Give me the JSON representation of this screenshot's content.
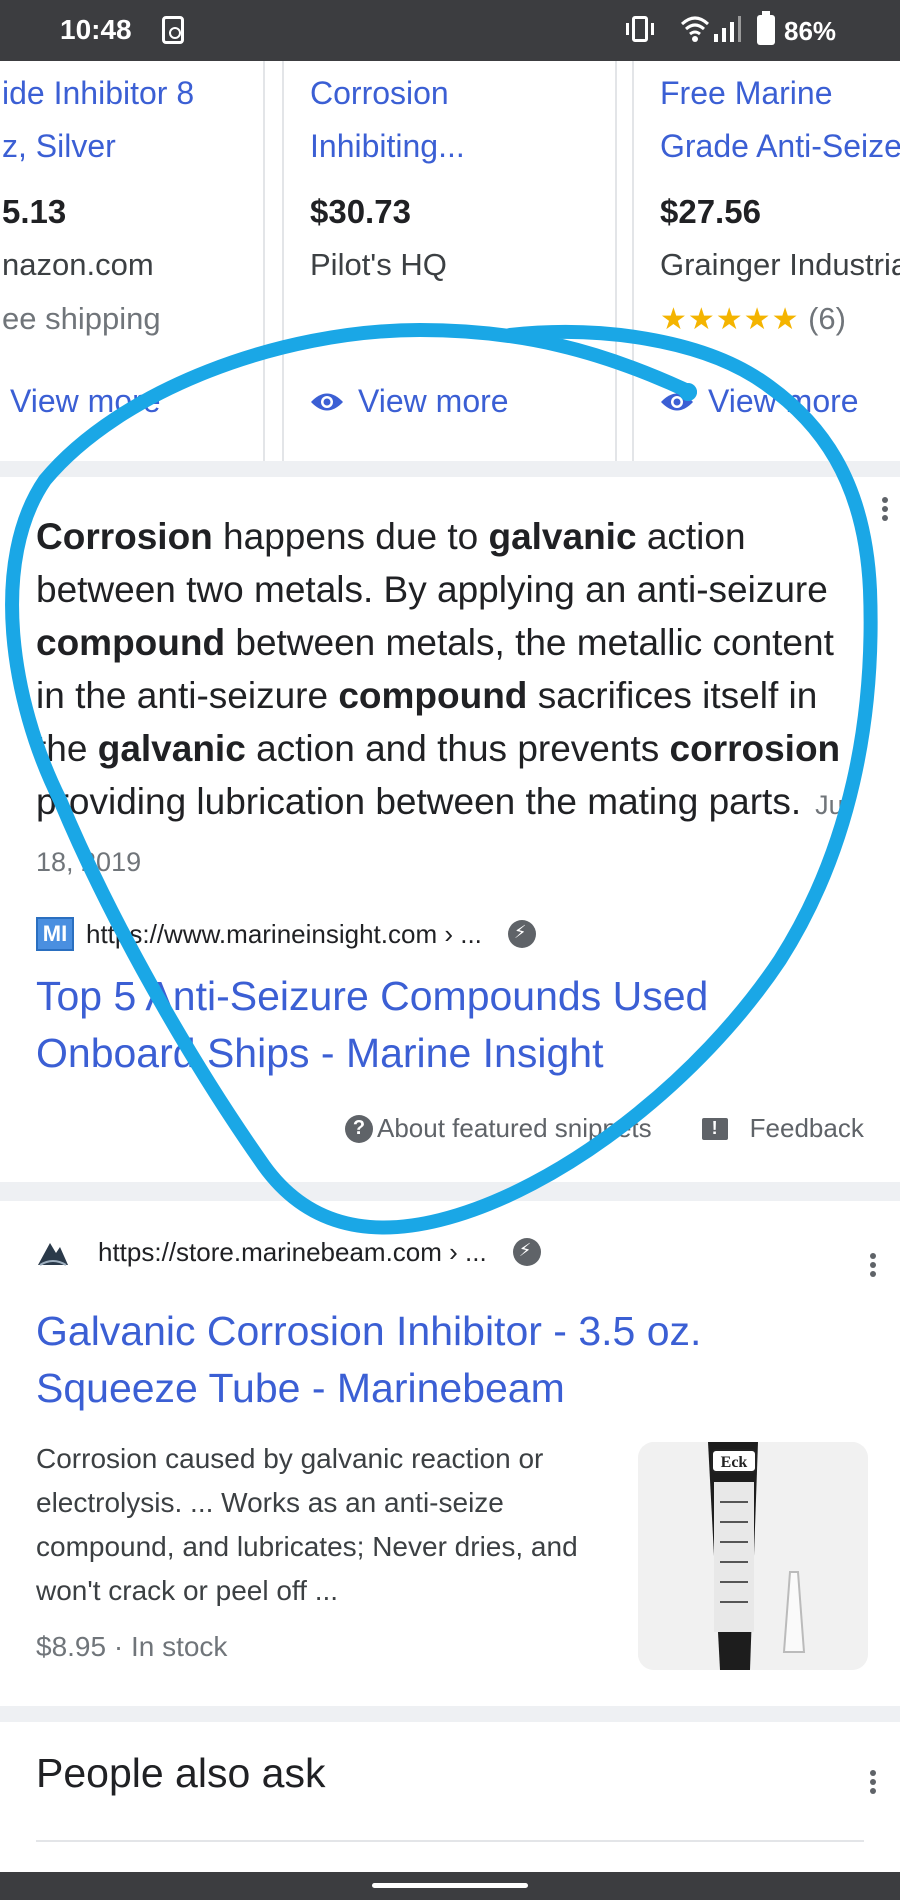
{
  "status_bar": {
    "time": "10:48",
    "battery": "86%"
  },
  "carousel": [
    {
      "title": [
        "ide Inhibitor 8",
        "z, Silver"
      ],
      "price": "5.13",
      "store": "nazon.com",
      "extra": "ee shipping",
      "view_label": "View more"
    },
    {
      "title": [
        "Corrosion",
        "Inhibiting..."
      ],
      "price": "$30.73",
      "store": "Pilot's HQ",
      "extra": "",
      "view_label": "View more"
    },
    {
      "title": [
        "Free Marine",
        "Grade Anti-Seize"
      ],
      "price": "$27.56",
      "store": "Grainger Industrial",
      "stars": "★★★★★",
      "rating_count": "(6)",
      "view_label": "View more"
    }
  ],
  "snippet": {
    "segments": [
      {
        "t": "Corrosion",
        "b": true
      },
      {
        "t": " happens due to ",
        "b": false
      },
      {
        "t": "galvanic",
        "b": true
      },
      {
        "t": " action between two metals. By applying an anti-seizure ",
        "b": false
      },
      {
        "t": "compound",
        "b": true
      },
      {
        "t": " between metals, the metallic content in the anti-seizure ",
        "b": false
      },
      {
        "t": "compound",
        "b": true
      },
      {
        "t": " sacrifices itself in the ",
        "b": false
      },
      {
        "t": "galvanic",
        "b": true
      },
      {
        "t": " action and thus prevents ",
        "b": false
      },
      {
        "t": "corrosion",
        "b": true
      },
      {
        "t": " providing lubrication between the mating parts.",
        "b": false
      }
    ],
    "date": "Jul 18, 2019",
    "source_logo": "MI",
    "source_url": "https://www.marineinsight.com › ...",
    "title": "Top 5 Anti-Seizure Compounds Used Onboard Ships - Marine Insight",
    "about_label": "About featured snippets",
    "feedback_label": "Feedback"
  },
  "result": {
    "source_url": "https://store.marinebeam.com › ...",
    "title": "Galvanic Corrosion Inhibitor - 3.5 oz. Squeeze Tube - Marinebeam",
    "description": "Corrosion caused by galvanic reaction or electrolysis. ... Works as an anti-seize compound, and lubricates; Never dries, and won't crack or peel off ...",
    "meta": "$8.95 · In stock",
    "thumb_brand": "Eck"
  },
  "people_also_ask": {
    "title": "People also ask"
  },
  "colors": {
    "link": "#3b5fd4",
    "annotation": "#1aa7e6",
    "star": "#f4b400"
  }
}
